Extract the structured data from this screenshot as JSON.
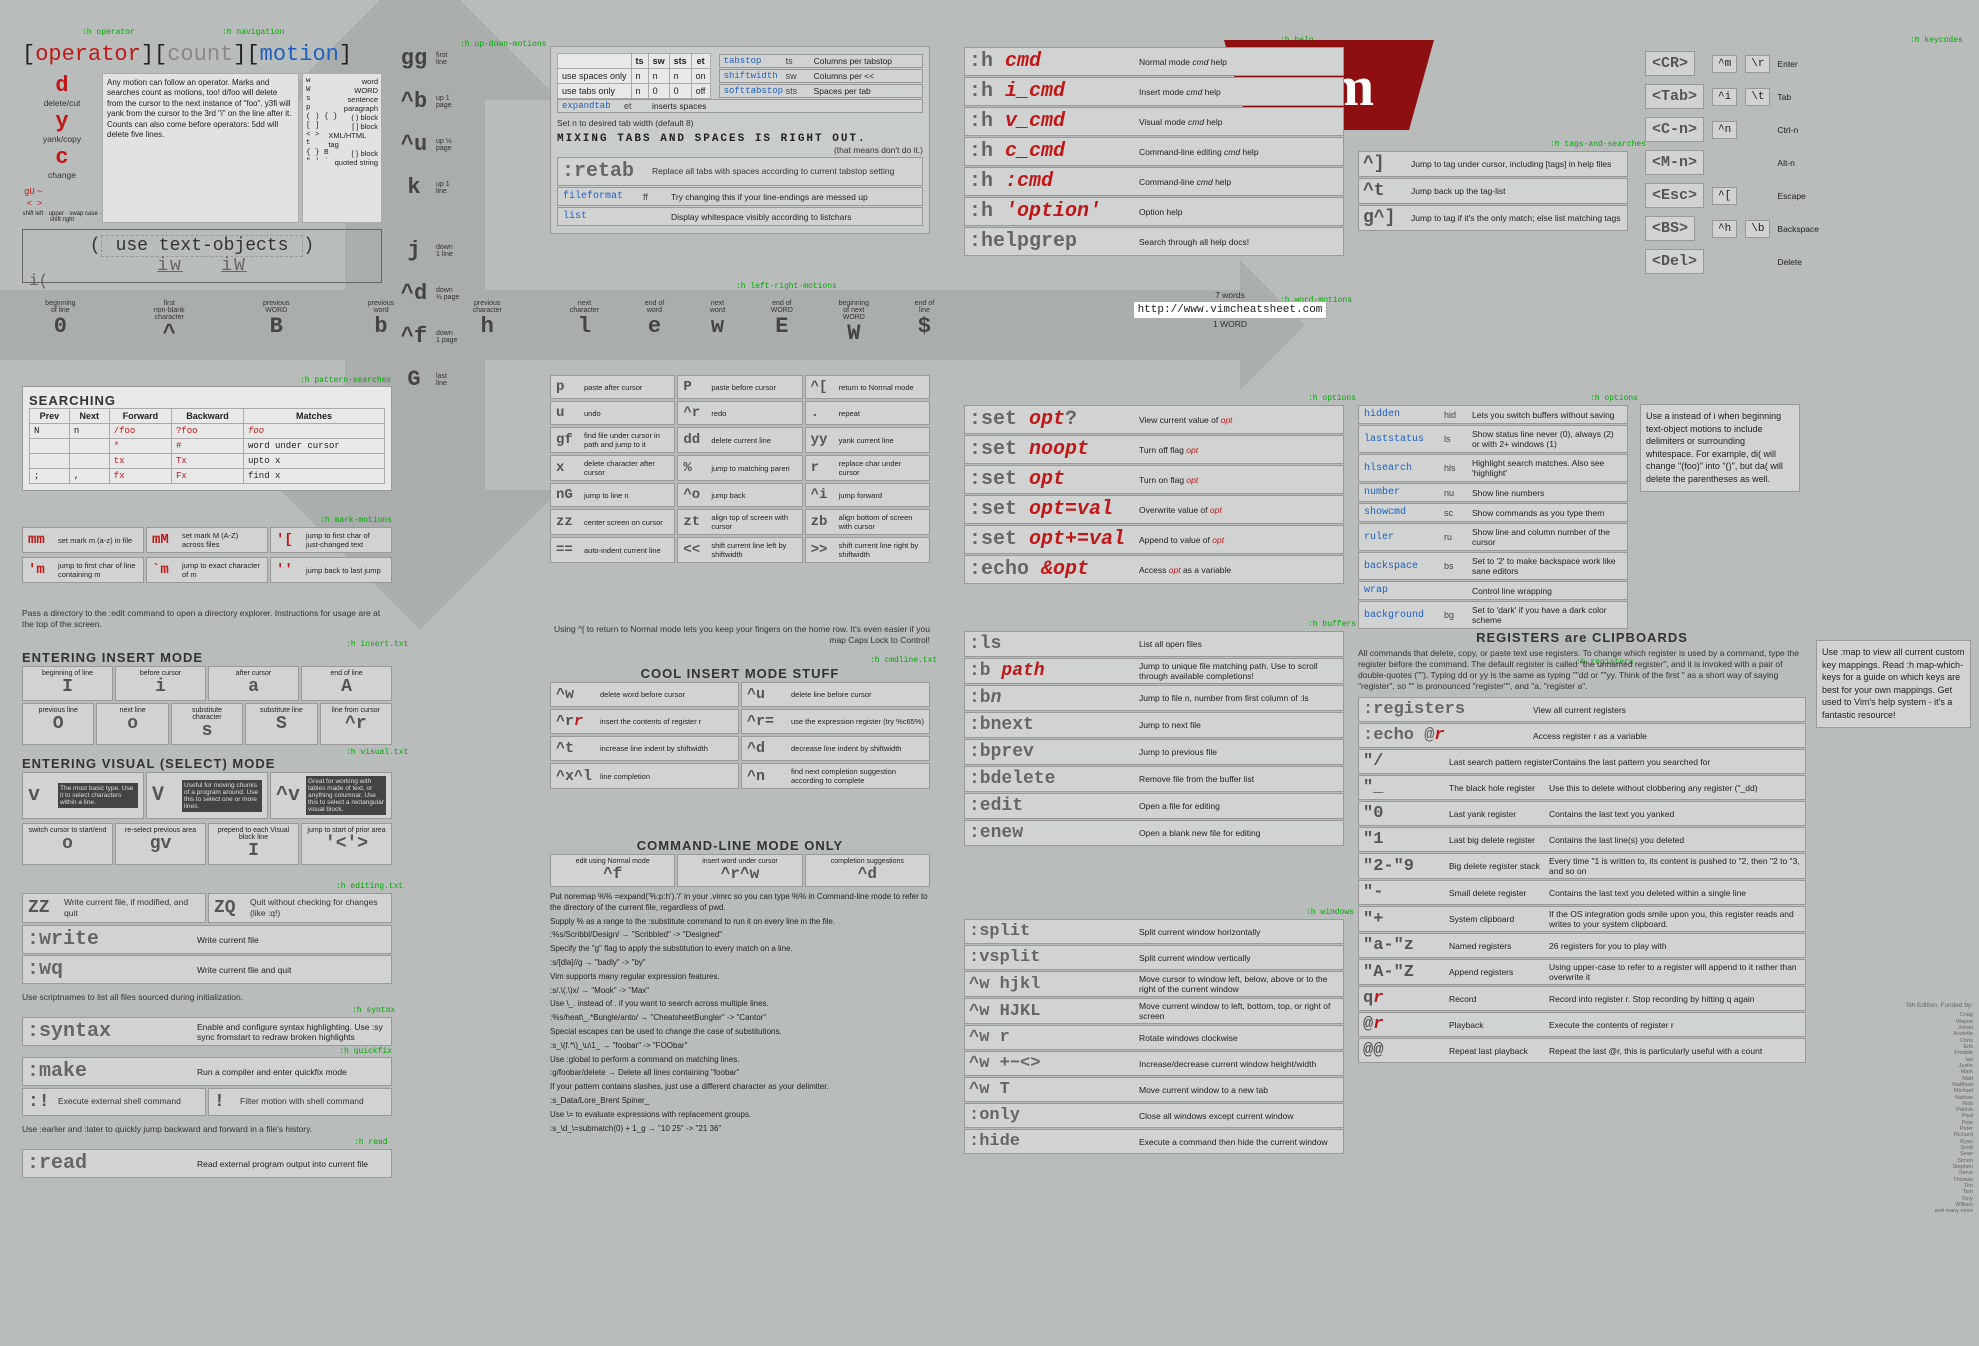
{
  "header": {
    "operator": "operator",
    "count": "count",
    "motion": "motion",
    "op_d": "d",
    "op_d_desc": "delete/cut",
    "op_y": "y",
    "op_y_desc": "yank/copy",
    "op_c": "c",
    "op_c_desc": "change",
    "gU": "gU",
    "tilde": "~",
    "lab1": "shift left",
    "gt": ">",
    "lt": "<",
    "lab2": "shift right",
    "lab3": "upper",
    "lab4": "swap case",
    "text_objects_lbl": "use text-objects",
    "iw": "iw",
    "iW": "iW",
    "iparen": "i(",
    "explain": "Any motion can follow an operator. Marks and searches count as motions, too! d/foo will delete from the cursor to the next instance of \"foo\". y3fi will yank from the cursor to the 3rd \"i\" on the line after it. Counts can also come before operators: 5dd will delete five lines.",
    "obj_list": [
      [
        "w",
        "word"
      ],
      [
        "W",
        "WORD"
      ],
      [
        "s",
        "sentence"
      ],
      [
        "p",
        "paragraph"
      ],
      [
        "( ) { }",
        "( ) block"
      ],
      [
        "[ ]",
        "[ ] block"
      ],
      [
        "< > t",
        "XML/HTML tag"
      ],
      [
        "{ } B",
        "{ } block"
      ],
      [
        "\" ' `",
        "quoted string"
      ]
    ]
  },
  "nav_ud": [
    [
      "gg",
      "first\nline"
    ],
    [
      "^b",
      "up 1\npage"
    ],
    [
      "^u",
      "up ½\npage"
    ],
    [
      "k",
      "up 1\nline"
    ],
    [
      "j",
      "down\n1 line"
    ],
    [
      "^d",
      "down\n½ page"
    ],
    [
      "^f",
      "down\n1 page"
    ],
    [
      "G",
      "last\nline"
    ]
  ],
  "nav_lr_left": [
    [
      "0",
      "beginning\nof line"
    ],
    [
      "^",
      "first\nnon-blank\ncharacter"
    ],
    [
      "B",
      "previous\nWORD"
    ],
    [
      "b",
      "previous\nword"
    ],
    [
      "h",
      "previous\ncharacter"
    ]
  ],
  "nav_lr_right": [
    [
      "l",
      "next\ncharacter"
    ],
    [
      "e",
      "end of\nword"
    ],
    [
      "w",
      "next\nword"
    ],
    [
      "E",
      "end of\nWORD"
    ],
    [
      "W",
      "beginning\nof next\nWORD"
    ],
    [
      "$",
      "end of\nline"
    ]
  ],
  "words_demo": {
    "count": "7 words",
    "url": "http://www.vimcheatsheet.com",
    "wcount": "1 WORD"
  },
  "tabs": {
    "hdr": [
      "ts",
      "sw",
      "sts",
      "et"
    ],
    "rows": [
      [
        "use spaces only",
        "n",
        "n",
        "n",
        "on"
      ],
      [
        "use tabs only",
        "n",
        "0",
        "0",
        "off"
      ]
    ],
    "note": "Set n to desired tab width (default 8)",
    "settings": [
      [
        "tabstop",
        "ts",
        "Columns per tabstop"
      ],
      [
        "shiftwidth",
        "sw",
        "Columns per <<"
      ],
      [
        "softtabstop",
        "sts",
        "Spaces per tab"
      ],
      [
        "expandtab",
        "et",
        "<Tab> inserts spaces"
      ]
    ],
    "warn1": "MIXING TABS AND SPACES IS RIGHT OUT.",
    "warn2": "(that means don't do it.)",
    "retab": ":retab",
    "retab_desc": "Replace all tabs with spaces according to current tabstop setting",
    "ff": [
      "fileformat",
      "ff",
      "Try changing this if your line-endings are messed up"
    ],
    "list": [
      "list",
      "",
      "Display whitespace visibly according to listchars"
    ]
  },
  "help": [
    [
      ":h cmd",
      "Normal mode cmd help"
    ],
    [
      ":h i_cmd",
      "Insert mode cmd help"
    ],
    [
      ":h v_cmd",
      "Visual mode cmd help"
    ],
    [
      ":h c_cmd",
      "Command-line editing cmd help"
    ],
    [
      ":h :cmd",
      "Command-line cmd help"
    ],
    [
      ":h 'option'",
      "Option help"
    ],
    [
      ":helpgrep",
      "Search through all help docs!"
    ]
  ],
  "tags": [
    [
      "^]",
      "Jump to tag under cursor, including [tags] in help files"
    ],
    [
      "^t",
      "Jump back up the tag-list"
    ],
    [
      "g^]",
      "Jump to tag if it's the only match; else list matching tags"
    ]
  ],
  "keycodes": [
    [
      "<CR>",
      "^m",
      "\\r",
      "Enter"
    ],
    [
      "<Tab>",
      "^i",
      "\\t",
      "Tab"
    ],
    [
      "<C-n>",
      "^n",
      "",
      "Ctrl-n"
    ],
    [
      "<M-n>",
      "",
      "",
      "Alt-n"
    ],
    [
      "<Esc>",
      "^[",
      "",
      "Escape"
    ],
    [
      "<BS>",
      "^h",
      "\\b",
      "Backspace"
    ],
    [
      "<Del>",
      "",
      "",
      "Delete"
    ]
  ],
  "searching": {
    "title": "SEARCHING",
    "hdr": [
      "Prev",
      "Next",
      "Forward",
      "Backward",
      "Matches"
    ],
    "rows": [
      [
        "N",
        "n",
        "/foo",
        "?foo",
        "foo"
      ],
      [
        "",
        "",
        "*",
        "#",
        "word under cursor"
      ],
      [
        "",
        "",
        "tx",
        "Tx",
        "upto x"
      ],
      [
        ";",
        ",",
        "fx",
        "Fx",
        "find x"
      ]
    ]
  },
  "marks": [
    [
      "mm",
      "set mark m (a-z) in file"
    ],
    [
      "mM",
      "set mark M (A-Z) across files"
    ],
    [
      "'[",
      "jump to first char of just-changed text"
    ],
    [
      "'m",
      "jump to first char of line containing m"
    ],
    [
      "`m",
      "jump to exact character of m"
    ],
    [
      "''",
      "jump back to last jump"
    ]
  ],
  "norm_cmds": [
    [
      "p",
      "paste after cursor",
      "P",
      "paste before cursor",
      "^[",
      "return to Normal mode"
    ],
    [
      "u",
      "undo",
      "^r",
      "redo",
      ".",
      "repeat"
    ],
    [
      "gf",
      "find file under cursor in path and jump to it",
      "dd",
      "delete current line",
      "yy",
      "yank current line"
    ],
    [
      "x",
      "delete character after cursor",
      "%",
      "jump to matching paren",
      "r",
      "replace char under cursor"
    ],
    [
      "nG",
      "jump to line n",
      "^o",
      "jump back",
      "^i",
      "jump forward"
    ],
    [
      "zz",
      "center screen on cursor",
      "zt",
      "align top of screen with cursor",
      "zb",
      "align bottom of screen with cursor"
    ],
    [
      "==",
      "auto-indent current line",
      "<<",
      "shift current line left by shiftwidth",
      ">>",
      "shift current line right by shiftwidth"
    ]
  ],
  "edit_note": "Pass a directory to the :edit command to open a directory explorer. Instructions for usage are at the top of the screen.",
  "insert": {
    "title": "ENTERING INSERT MODE",
    "row1": [
      [
        "I",
        "beginning of line"
      ],
      [
        "i",
        "before cursor"
      ],
      [
        "a",
        "after cursor"
      ],
      [
        "A",
        "end of line"
      ]
    ],
    "row2": [
      [
        "O",
        "previous line"
      ],
      [
        "o",
        "next line"
      ],
      [
        "s",
        "substitute character"
      ],
      [
        "S",
        "substitute line"
      ],
      [
        "^r",
        "line from cursor"
      ]
    ]
  },
  "visual": {
    "title": "ENTERING VISUAL (SELECT) MODE",
    "row1": [
      [
        "v",
        "The most basic type. Use it to select characters within a line."
      ],
      [
        "V",
        "Useful for moving chunks of a program around. Use this to select one or more lines."
      ],
      [
        "^v",
        "Great for working with tables made of text, or anything columnar. Use this to select a rectangular visual block."
      ]
    ],
    "row2": [
      [
        "o",
        "switch cursor to start/end"
      ],
      [
        "gv",
        "re-select previous area"
      ],
      [
        "I",
        "prepend to each Visual block line"
      ],
      [
        "'<'>",
        "jump to start of prior area"
      ]
    ]
  },
  "writing": [
    [
      "ZZ",
      "Write current file, if modified, and quit",
      "ZQ",
      "Quit without checking for changes (like :q!)"
    ],
    [
      ":write",
      "Write current file"
    ],
    [
      ":wq",
      "Write current file and quit"
    ]
  ],
  "scriptnames": "Use scriptnames to list all files sourced during initialization.",
  "syntax": [
    [
      ":syntax",
      "Enable and configure syntax highlighting. Use :sy sync fromstart to redraw broken highlights"
    ],
    [
      ":make",
      "Run a compiler and enter quickfix mode"
    ],
    [
      ":!",
      "Execute external shell command",
      "!",
      "Filter motion with shell command"
    ]
  ],
  "earlier": "Use :earlier and :later to quickly jump backward and forward in a file's history.",
  "read": ":read",
  "read_desc": "Read external program output into current file",
  "undo_note": "Using ^[ to return to Normal mode lets you keep your fingers on the home row. It's even easier if you map Caps Lock to Control!",
  "cool_insert": {
    "title": "COOL INSERT MODE STUFF",
    "rows": [
      [
        "^w",
        "delete word before cursor",
        "^u",
        "delete line before cursor"
      ],
      [
        "^rr",
        "insert the contents of register r",
        "^r=",
        "use the expression register (try %c65%)"
      ],
      [
        "^t",
        "increase line indent by shiftwidth",
        "^d",
        "decrease line indent by shiftwidth"
      ],
      [
        "^x^l",
        "line completion",
        "^n",
        "find next completion suggestion according to complete"
      ]
    ]
  },
  "cmdline": {
    "title": "COMMAND-LINE MODE ONLY",
    "rows": [
      [
        "^f",
        "edit using Normal mode",
        "^r^w",
        "insert word under cursor",
        "^d",
        "completion suggestions"
      ]
    ],
    "notes": [
      "Put noremap %% <C-R>=expand('%:p:h').'/'<CR> in your .vimrc so you can type %% in Command-line mode to refer to the directory of the current file, regardless of pwd.",
      "Supply % as a range to the :substitute command to run it on every line in the file.",
      ":%s/Scribbl/Design/ → \"Scribbled\" -> \"Designed\"",
      "Specify the \"g\" flag to apply the substitution to every match on a line.",
      ":s/[dla]//g → \"badly\" -> \"by\"",
      "Vim supports many regular expression features.",
      ":s/.\\(.\\)x/ → \"Mook\" -> \"Max\"",
      "Use \\_. instead of . if you want to search across multiple lines.",
      ":%s/heat\\_.*Bungle/anto/ → \"CheatsheetBungler\" -> \"Cantor\"",
      "Special escapes can be used to change the case of substitutions.",
      ":s_\\(f.*\\)_\\u\\1_ → \"foobar\" -> \"FOObar\"",
      "Use :global to perform a command on matching lines.",
      ":g/foobar/delete → Delete all lines containing \"foobar\"",
      "If your pattern contains slashes, just use a different character as your delimiter.",
      ":s_Data/Lore_Brent Spiner_",
      "Use \\= to evaluate expressions with replacement groups.",
      ":s_\\d_\\=submatch(0) + 1_g → \"10 25\" -> \"21 36\""
    ]
  },
  "set": [
    [
      ":set opt?",
      "View current value of opt"
    ],
    [
      ":set noopt",
      "Turn off flag opt"
    ],
    [
      ":set opt",
      "Turn on flag opt"
    ],
    [
      ":set opt=val",
      "Overwrite value of opt"
    ],
    [
      ":set opt+=val",
      "Append to value of opt"
    ],
    [
      ":echo &opt",
      "Access opt as a variable"
    ]
  ],
  "buffers": [
    [
      ":ls",
      "List all open files"
    ],
    [
      ":b path",
      "Jump to unique file matching path. Use <Tab> to scroll through available completions!"
    ],
    [
      ":bn",
      "Jump to file n, number from first column of :ls"
    ],
    [
      ":bnext",
      "Jump to next file"
    ],
    [
      ":bprev",
      "Jump to previous file"
    ],
    [
      ":bdelete",
      "Remove file from the buffer list"
    ],
    [
      ":edit",
      "Open a file for editing"
    ],
    [
      ":enew",
      "Open a blank new file for editing"
    ]
  ],
  "windows": [
    [
      ":split",
      "Split current window horizontally"
    ],
    [
      ":vsplit",
      "Split current window vertically"
    ],
    [
      "^w hjkl",
      "Move cursor to window left, below, above or to the right of the current window"
    ],
    [
      "^w HJKL",
      "Move current window to left, bottom, top, or right of screen"
    ],
    [
      "^w r",
      "Rotate windows clockwise"
    ],
    [
      "^w +−<>",
      "Increase/decrease current window height/width"
    ],
    [
      "^w T",
      "Move current window to a new tab"
    ],
    [
      ":only",
      "Close all windows except current window"
    ],
    [
      ":hide",
      "Execute a command then hide the current window"
    ]
  ],
  "options": [
    [
      "hidden",
      "hid",
      "Lets you switch buffers without saving"
    ],
    [
      "laststatus",
      "ls",
      "Show status line never (0), always (2) or with 2+ windows (1)"
    ],
    [
      "hlsearch",
      "hls",
      "Highlight search matches. Also see 'highlight'"
    ],
    [
      "number",
      "nu",
      "Show line numbers"
    ],
    [
      "showcmd",
      "sc",
      "Show commands as you type them"
    ],
    [
      "ruler",
      "ru",
      "Show line and column number of the cursor"
    ],
    [
      "backspace",
      "bs",
      "Set to '2' to make backspace work like sane editors"
    ],
    [
      "wrap",
      "",
      "Control line wrapping"
    ],
    [
      "background",
      "bg",
      "Set to 'dark' if you have a dark color scheme"
    ]
  ],
  "registers": {
    "title": "REGISTERS are CLIPBOARDS",
    "intro": "All commands that delete, copy, or paste text use registers. To change which register is used by a command, type the register before the command. The default register is called \"the unnamed register\", and it is invoked with a pair of double-quotes (\"\"). Typing dd or yy is the same as typing \"\"dd or \"\"yy. Think of the first \" as a short way of saying \"register\", so \"\" is pronounced \"register\"\", and \"a, \"register a\".",
    "rows": [
      [
        ":registers",
        "View all current registers"
      ],
      [
        ":echo @r",
        "Access register r as a variable"
      ],
      [
        "\"/",
        "Last search pattern register",
        "Contains the last pattern you searched for"
      ],
      [
        "\"_",
        "The black hole register",
        "Use this to delete without clobbering any register (\"_dd)"
      ],
      [
        "\"0",
        "Last yank register",
        "Contains the last text you yanked"
      ],
      [
        "\"1",
        "Last big delete register",
        "Contains the last line(s) you deleted"
      ],
      [
        "\"2-\"9",
        "Big delete register stack",
        "Every time \"1 is written to, its content is pushed to \"2, then \"2 to \"3, and so on"
      ],
      [
        "\"-",
        "Small delete register",
        "Contains the last text you deleted within a single line"
      ],
      [
        "\"+",
        "System clipboard",
        "If the OS integration gods smile upon you, this register reads and writes to your system clipboard."
      ],
      [
        "\"a-\"z",
        "Named registers",
        "26 registers for you to play with"
      ],
      [
        "\"A-\"Z",
        "Append registers",
        "Using upper-case to refer to a register will append to it rather than overwrite it"
      ],
      [
        "qr",
        "Record",
        "Record into register r. Stop recording by hitting q again"
      ],
      [
        "@r",
        "Playback",
        "Execute the contents of register r"
      ],
      [
        "@@",
        "Repeat last playback",
        "Repeat the last @r, this is particularly useful with a count"
      ]
    ]
  },
  "txtobj_note": "Use a instead of i when beginning text-object motions to include delimiters or surrounding whitespace. For example, di( will change \"(foo)\" into \"()\", but da( will delete the parentheses as well.",
  "map_note": "Use :map to view all current custom key mappings. Read :h map-which-keys for a guide on which keys are best for your own mappings. Get used to Vim's help system - it's a fantastic resource!",
  "credits_title": "5th Edition. Funded by:",
  "credits": [
    "Craig",
    "Wayne",
    "Johan",
    "Aristotle",
    "Chris",
    "Erik",
    "Freddie",
    "Ian",
    "Justin",
    "Mark",
    "Matt",
    "Matthew",
    "Michael",
    "Nathan",
    "Nick",
    "Patrick",
    "Paul",
    "Pete",
    "Peter",
    "Richard",
    "Ryan",
    "Scott",
    "Sean",
    "Simon",
    "Stephen",
    "Steve",
    "Thomas",
    "Tim",
    "Tom",
    "Tony",
    "William",
    "and many more"
  ]
}
